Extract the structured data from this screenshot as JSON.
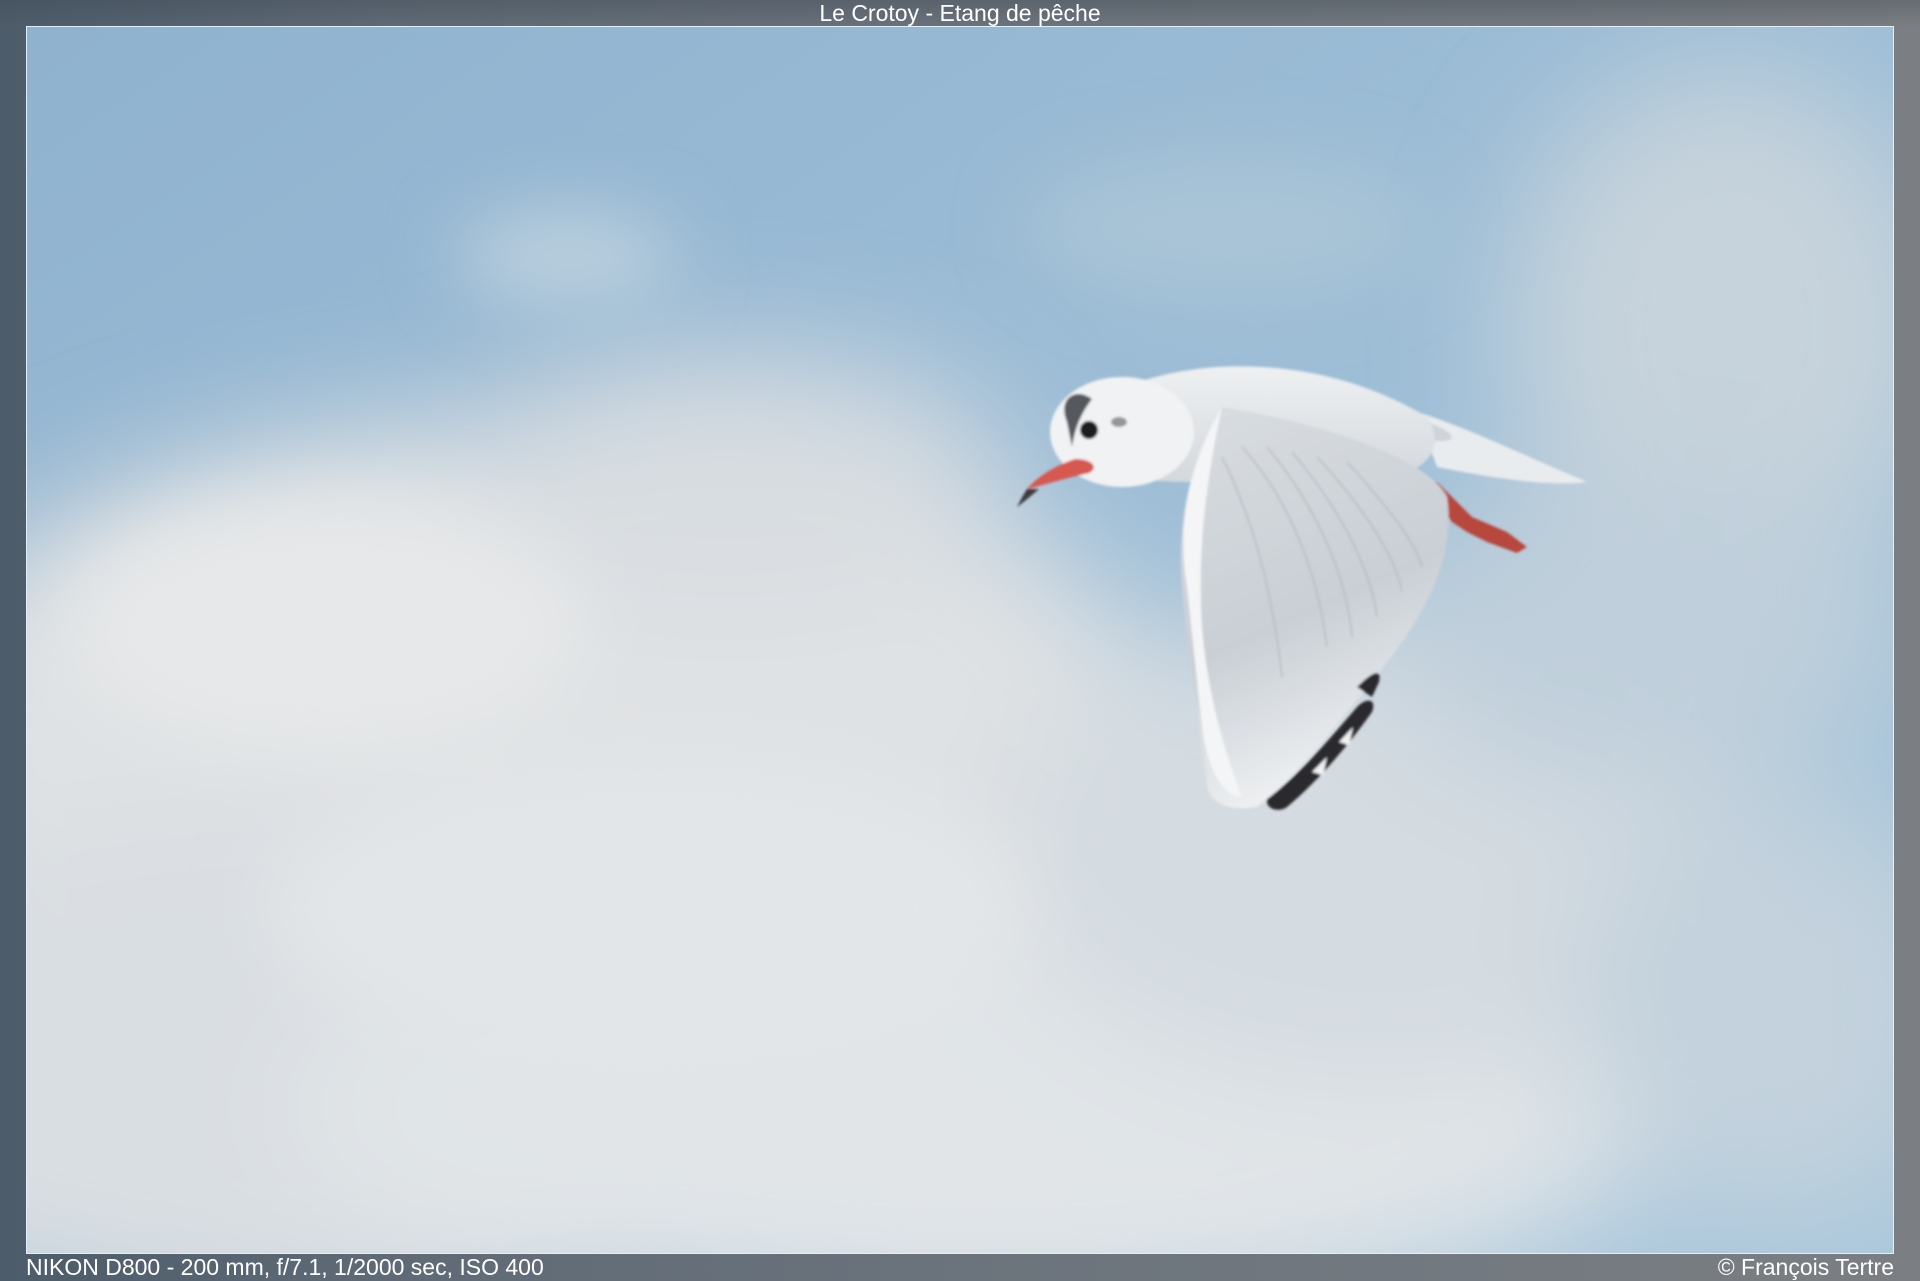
{
  "header": {
    "title": "Le Crotoy - Etang de pêche"
  },
  "footer": {
    "exif": "NIKON D800 - 200 mm, f/7.1, 1/2000 sec, ISO 400",
    "credit": "© François Tertre"
  },
  "photo": {
    "subject": "gull-in-flight",
    "colors": {
      "sky": "#93b8d4",
      "cloud": "#dfe3e6",
      "bill": "#d6584f",
      "legs": "#b8473c",
      "wing_tip": "#2a2a2e"
    }
  }
}
